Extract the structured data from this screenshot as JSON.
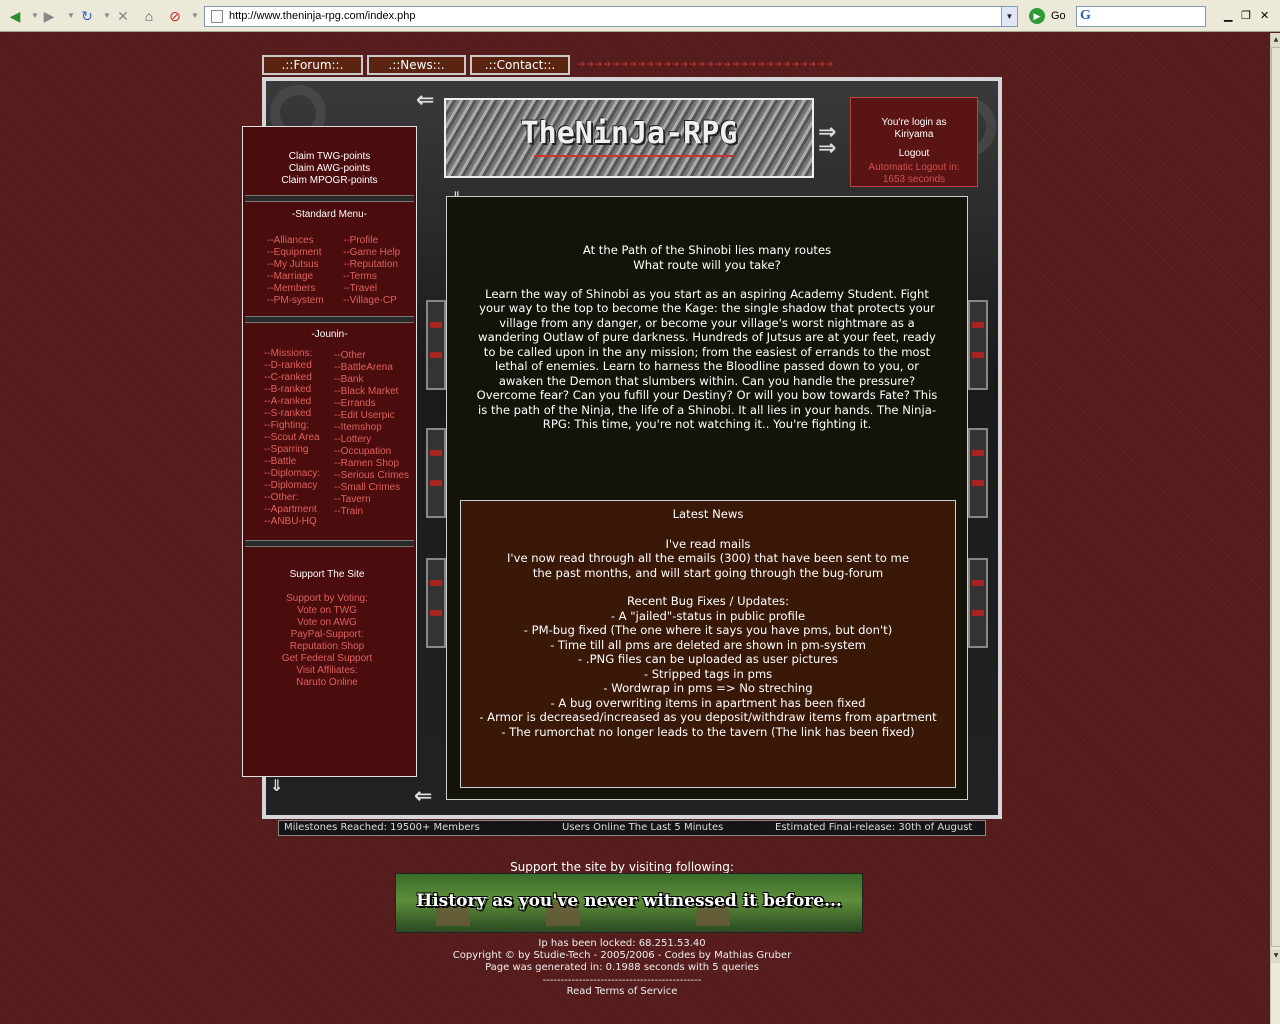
{
  "browser": {
    "url": "http://www.theninja-rpg.com/index.php",
    "go_label": "Go",
    "search_logo": "G"
  },
  "tabs": [
    ".::Forum::.",
    ".::News::.",
    ".::Contact::."
  ],
  "logo": "TheNinJa-RPG",
  "login": {
    "line1": "You're login as",
    "username": "Kiriyama",
    "logout": "Logout",
    "auto_logout_1": "Automatic Logout in:",
    "auto_logout_2": "1653 seconds"
  },
  "claims": [
    "Claim TWG-points",
    "Claim AWG-points",
    "Claim MPOGR-points"
  ],
  "standard_menu": {
    "heading": "-Standard Menu-",
    "left": [
      "--Alliances",
      "--Equipment",
      "--My Jutsus",
      "--Marriage",
      "--Members",
      "--PM-system"
    ],
    "right": [
      "--Profile",
      "--Game Help",
      "--Reputation",
      "--Terms",
      "--Travel",
      "--Village-CP"
    ]
  },
  "jounin_menu": {
    "heading": "-Jounin-",
    "left": [
      "--Missions:",
      "--D-ranked",
      "--C-ranked",
      "--B-ranked",
      "--A-ranked",
      "--S-ranked",
      "--Fighting:",
      "--Scout Area",
      "--Sparring",
      "--Battle",
      "--Diplomacy:",
      "--Diplomacy",
      "--Other:",
      "--Apartment",
      "--ANBU-HQ"
    ],
    "right": [
      "--Other",
      "--BattleArena",
      "--Bank",
      "--Black Market",
      "--Errands",
      "--Edit Userpic",
      "--Itemshop",
      "--Lottery",
      "--Occupation",
      "--Ramen Shop",
      "--Serious Crimes",
      "--Small Crimes",
      "--Tavern",
      "--Train"
    ]
  },
  "support": {
    "heading": "Support The Site",
    "links": [
      "Support by Voting:",
      "Vote on TWG",
      "Vote on AWG",
      "PayPal-Support:",
      "Reputation Shop",
      "Get Federal Support",
      "Visit Affiliates:",
      "Naruto Online"
    ]
  },
  "intro": {
    "line1": "At the Path of the Shinobi lies many routes",
    "line2": "What route will you take?",
    "body": "Learn the way of Shinobi as you start as an aspiring Academy Student. Fight your way to the top to become the Kage: the single shadow that protects your village from any danger, or become your village's worst nightmare as a wandering Outlaw of pure darkness. Hundreds of Jutsus are at your feet, ready to be called upon in the any mission; from the easiest of errands to the most lethal of enemies. Learn to harness the Bloodline passed down to you, or awaken the Demon that slumbers within. Can you handle the pressure? Overcome fear? Can you fufill your Destiny? Or will you bow towards Fate? This is the path of the Ninja, the life of a Shinobi. It all lies in your hands. The Ninja-RPG: This time, you're not watching it.. You're fighting it."
  },
  "news": {
    "title": "Latest News",
    "headline": "I've read mails",
    "body1": "I've now read through all the emails (300) that have been sent to me",
    "body2": "the past months, and will start going through the bug-forum",
    "updates_title": "Recent Bug Fixes / Updates:",
    "items": [
      "- A \"jailed\"-status in public profile",
      "- PM-bug fixed (The one where it says you have pms, but don't)",
      "- Time till all pms are deleted are shown in pm-system",
      "- .PNG files can be uploaded as user pictures",
      "- Stripped tags in pms",
      "- Wordwrap in pms => No streching",
      "- A bug overwriting items in apartment has been fixed",
      "- Armor is decreased/increased as you deposit/withdraw items from apartment",
      "- The rumorchat no longer leads to the tavern (The link has been fixed)"
    ]
  },
  "status": {
    "milestones": "Milestones Reached: 19500+ Members",
    "online": "Users Online The Last 5 Minutes",
    "release": "Estimated Final-release: 30th of August"
  },
  "footer": {
    "support_visit": "Support the site by visiting following:",
    "banner_text": "History as you've never witnessed it before...",
    "ip": "Ip has been locked: 68.251.53.40",
    "copyright": "Copyright © by Studie-Tech - 2005/2006 - Codes by Mathias Gruber",
    "generated": "Page was generated in: 0.1988 seconds with 5 queries",
    "separator": "--------------------------------------------",
    "terms": "Read Terms of Service"
  },
  "colors": {
    "background": "#5a1e1e",
    "menu_bg": "#4a0c0c",
    "link_red": "#e06060",
    "news_bg": "#3a1808",
    "content_bg": "#13130a"
  }
}
